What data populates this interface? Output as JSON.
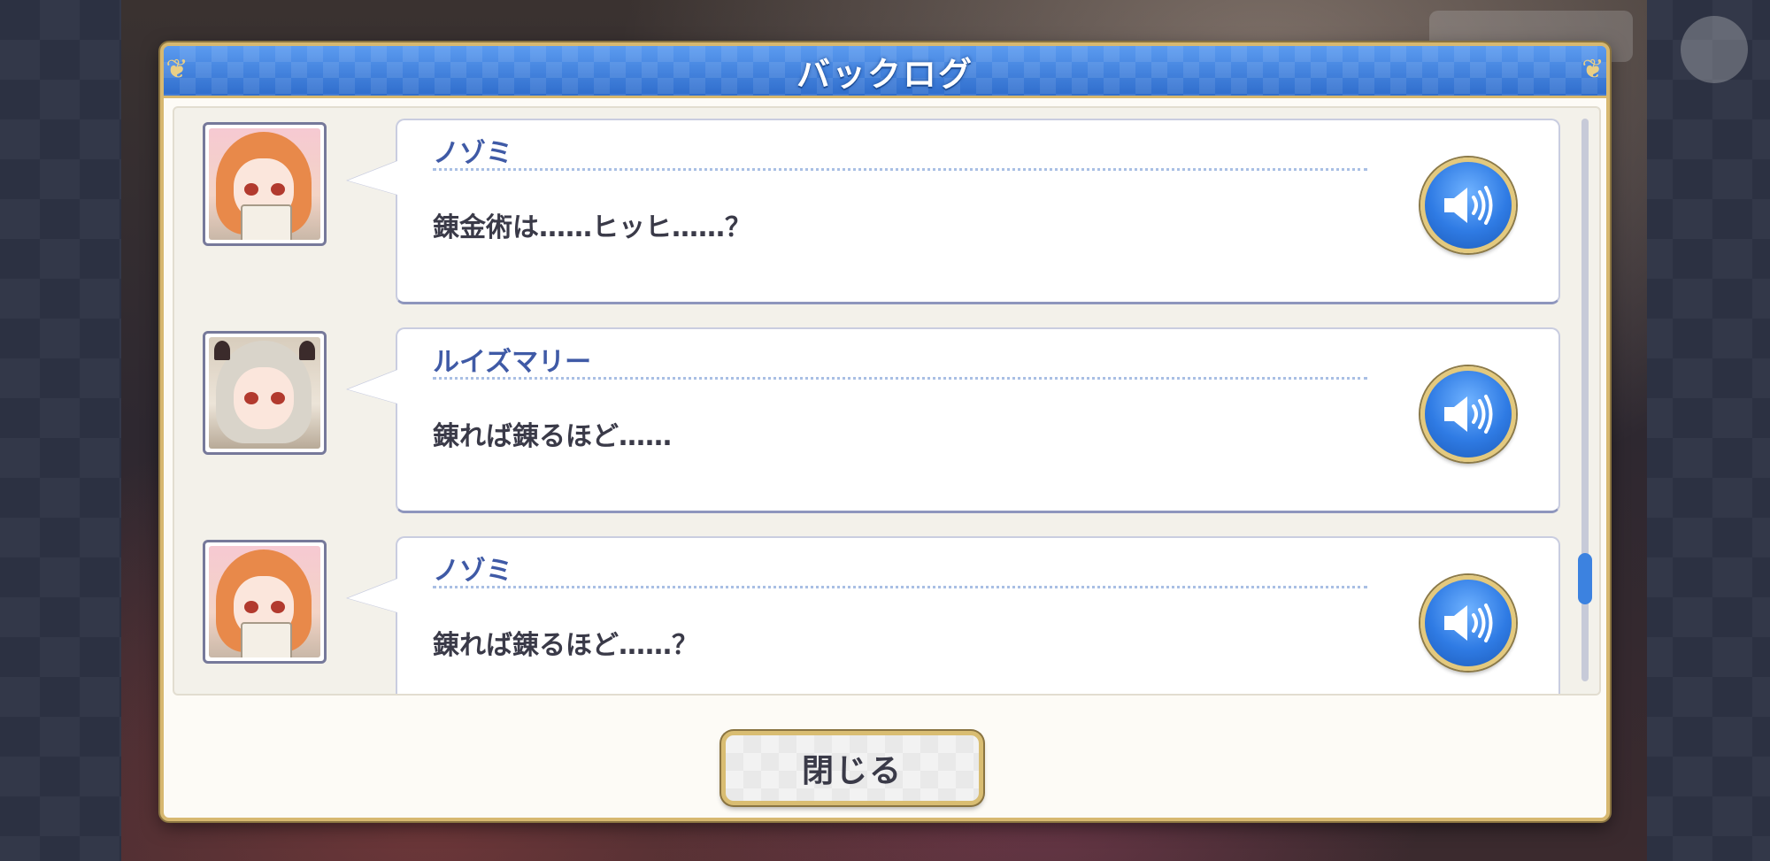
{
  "dialog": {
    "title": "バックログ",
    "close_label": "閉じる"
  },
  "entries": [
    {
      "speaker": "ノゾミ",
      "text": "錬金術は……ヒッヒ……？"
    },
    {
      "speaker": "ルイズマリー",
      "text": "錬れば錬るほど……"
    },
    {
      "speaker": "ノゾミ",
      "text": "錬れば錬るほど……？"
    }
  ],
  "scroll": {
    "position": 0.85
  },
  "colors": {
    "header_blue": "#3f7fda",
    "gold_border": "#d7b870",
    "speaker_name": "#3f5aa6",
    "voice_button": "#2f7be4"
  },
  "icons": {
    "voice": "speaker-volume-icon",
    "corner": "ornament-corner-icon"
  }
}
